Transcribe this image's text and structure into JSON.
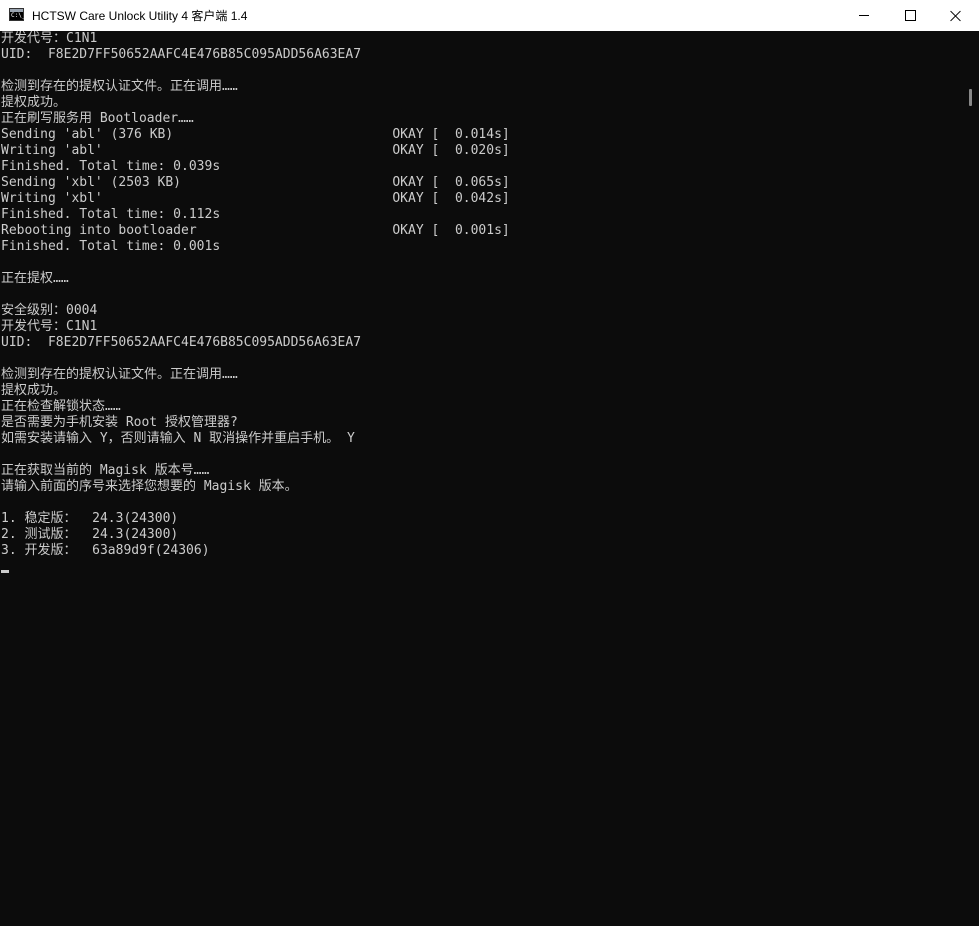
{
  "window": {
    "title": "HCTSW Care Unlock Utility 4 客户端 1.4",
    "icon_text": "C:\\_",
    "icon": "console-app-icon",
    "controls": {
      "minimize": "minimize-icon",
      "maximize": "maximize-icon",
      "close": "close-icon"
    }
  },
  "colors": {
    "console_background": "#0c0c0c",
    "console_text": "#cccccc",
    "titlebar_background": "#ffffff"
  },
  "console": {
    "lines": [
      "开发代号：C1N1",
      "UID:  F8E2D7FF50652AAFC4E476B85C095ADD56A63EA7",
      "",
      "检测到存在的提权认证文件。正在调用……",
      "提权成功。",
      "正在刷写服务用 Bootloader……",
      "Sending 'abl' (376 KB)                            OKAY [  0.014s]",
      "Writing 'abl'                                     OKAY [  0.020s]",
      "Finished. Total time: 0.039s",
      "Sending 'xbl' (2503 KB)                           OKAY [  0.065s]",
      "Writing 'xbl'                                     OKAY [  0.042s]",
      "Finished. Total time: 0.112s",
      "Rebooting into bootloader                         OKAY [  0.001s]",
      "Finished. Total time: 0.001s",
      "",
      "正在提权……",
      "",
      "安全级别：0004",
      "开发代号：C1N1",
      "UID:  F8E2D7FF50652AAFC4E476B85C095ADD56A63EA7",
      "",
      "检测到存在的提权认证文件。正在调用……",
      "提权成功。",
      "正在检查解锁状态……",
      "是否需要为手机安装 Root 授权管理器?",
      "如需安装请输入 Y，否则请输入 N 取消操作并重启手机。 Y",
      "",
      "正在获取当前的 Magisk 版本号……",
      "请输入前面的序号来选择您想要的 Magisk 版本。",
      "",
      "1. 稳定版：  24.3(24300)",
      "2. 测试版：  24.3(24300)",
      "3. 开发版：  63a89d9f(24306)"
    ]
  }
}
